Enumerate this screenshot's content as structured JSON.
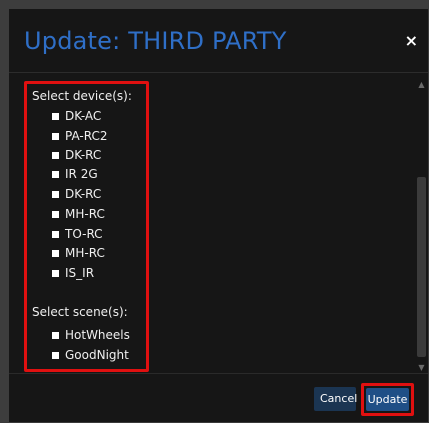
{
  "modal": {
    "title": "Update: THIRD PARTY",
    "close_symbol": "×"
  },
  "devices": {
    "label": "Select device(s):",
    "items": [
      "DK-AC",
      "PA-RC2",
      "DK-RC",
      "IR 2G",
      "DK-RC",
      "MH-RC",
      "TO-RC",
      "MH-RC",
      "IS_IR"
    ]
  },
  "scenes": {
    "label": "Select scene(s):",
    "items": [
      "HotWheels",
      "GoodNight"
    ]
  },
  "footer": {
    "cancel_label": "Cancel",
    "update_label": "Update"
  },
  "colors": {
    "title": "#2f6fc7",
    "highlight": "#e01010",
    "modal_bg": "#161616",
    "button": "#1f4f86"
  },
  "icons": {
    "close": "close-icon",
    "scroll_up": "chevron-up-icon",
    "scroll_down": "chevron-down-icon"
  }
}
